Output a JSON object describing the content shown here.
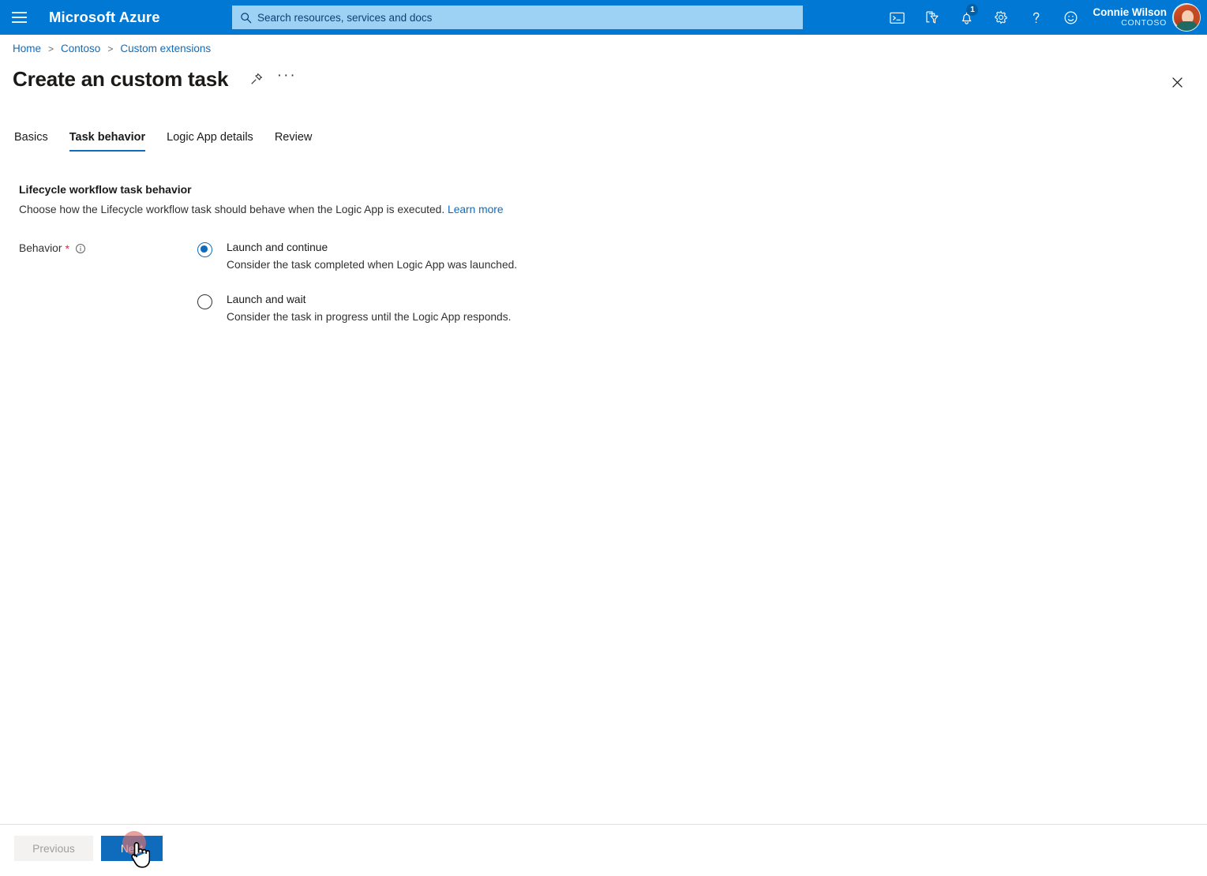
{
  "header": {
    "menu_icon": "hamburger-icon",
    "brand": "Microsoft Azure",
    "search": {
      "placeholder": "Search resources, services and docs",
      "value": "",
      "icon": "search-icon"
    },
    "icons": [
      {
        "name": "cloud-shell-icon",
        "title": "Cloud Shell"
      },
      {
        "name": "directory-filter-icon",
        "title": "Directories + subscriptions"
      },
      {
        "name": "notifications-bell-icon",
        "title": "Notifications",
        "badge": "1"
      },
      {
        "name": "settings-gear-icon",
        "title": "Settings"
      },
      {
        "name": "help-question-icon",
        "title": "Help"
      },
      {
        "name": "feedback-smiley-icon",
        "title": "Feedback"
      }
    ],
    "account": {
      "name": "Connie Wilson",
      "org": "CONTOSO",
      "avatar": "user-avatar"
    }
  },
  "breadcrumb": {
    "items": [
      {
        "label": "Home"
      },
      {
        "label": "Contoso"
      },
      {
        "label": "Custom extensions"
      }
    ],
    "separator": ">"
  },
  "page": {
    "title": "Create an custom task",
    "pin_icon": "pin-icon",
    "more_icon": "ellipsis-icon",
    "close_icon": "close-icon"
  },
  "tabs": [
    {
      "label": "Basics",
      "active": false
    },
    {
      "label": "Task behavior",
      "active": true
    },
    {
      "label": "Logic App details",
      "active": false
    },
    {
      "label": "Review",
      "active": false
    }
  ],
  "content": {
    "section_heading": "Lifecycle workflow task behavior",
    "section_description": "Choose how the Lifecycle workflow task should behave when the Logic App is executed.",
    "learn_more": "Learn more",
    "field": {
      "label": "Behavior",
      "required_marker": "*",
      "info_icon": "info-icon"
    },
    "options": [
      {
        "title": "Launch and continue",
        "description": "Consider the task completed when Logic App was launched.",
        "selected": true
      },
      {
        "title": "Launch and wait",
        "description": "Consider the task in progress until the Logic App responds.",
        "selected": false
      }
    ]
  },
  "footer": {
    "previous_label": "Previous",
    "next_label": "Next"
  },
  "colors": {
    "azure_blue": "#0078d4",
    "accent_link": "#0f6cbd",
    "search_field": "#9ed2f4",
    "required_red": "#c4314b",
    "click_indicator": "#d9706d"
  }
}
